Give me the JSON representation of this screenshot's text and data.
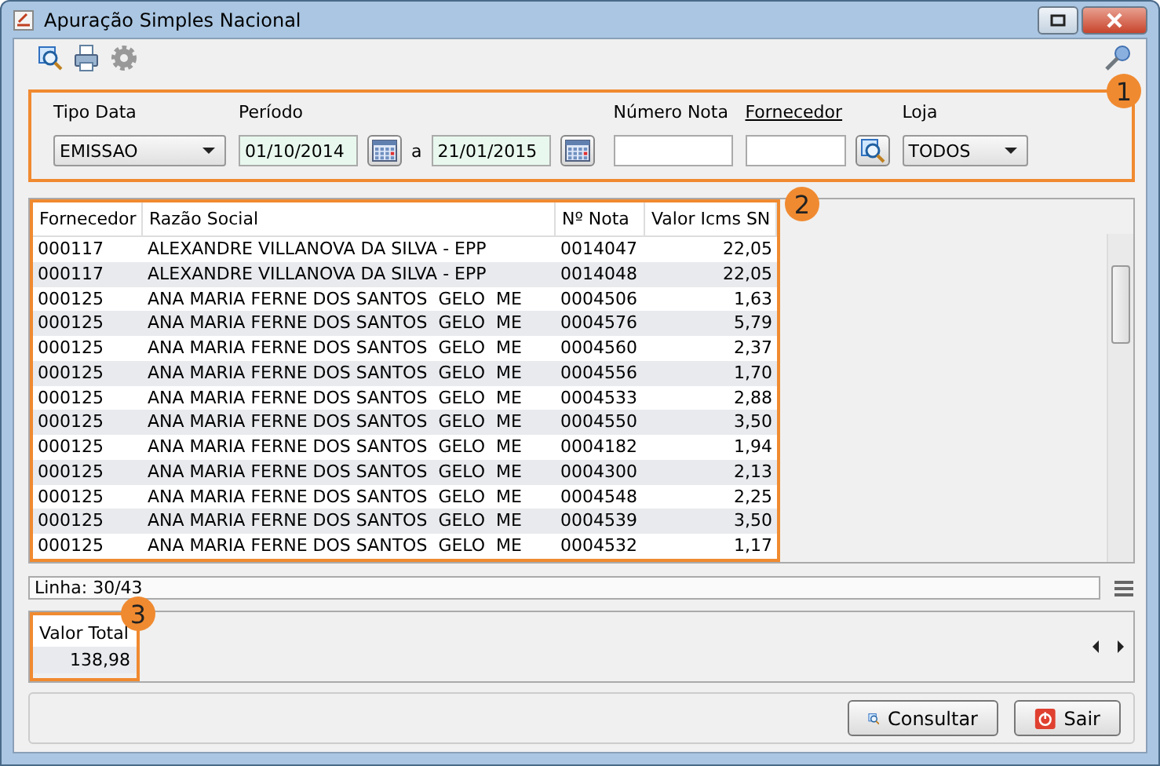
{
  "window": {
    "title": "Apuração Simples Nacional"
  },
  "filters": {
    "tipo_data": {
      "label": "Tipo Data",
      "value": "EMISSAO"
    },
    "periodo": {
      "label": "Período",
      "from": "01/10/2014",
      "separator": "a",
      "to": "21/01/2015"
    },
    "numero_nota": {
      "label": "Número Nota"
    },
    "fornecedor": {
      "label": "Fornecedor",
      "link": true
    },
    "loja": {
      "label": "Loja",
      "value": "TODOS"
    },
    "callout": "1"
  },
  "table": {
    "callout": "2",
    "columns": [
      "Fornecedor",
      "Razão Social",
      "Nº Nota",
      "Valor Icms SN"
    ],
    "rows": [
      [
        "000117",
        "ALEXANDRE VILLANOVA DA SILVA - EPP",
        "0014047",
        "22,05"
      ],
      [
        "000117",
        "ALEXANDRE VILLANOVA DA SILVA - EPP",
        "0014048",
        "22,05"
      ],
      [
        "000125",
        "ANA MARIA FERNE DOS SANTOS  GELO  ME",
        "0004506",
        "1,63"
      ],
      [
        "000125",
        "ANA MARIA FERNE DOS SANTOS  GELO  ME",
        "0004576",
        "5,79"
      ],
      [
        "000125",
        "ANA MARIA FERNE DOS SANTOS  GELO  ME",
        "0004560",
        "2,37"
      ],
      [
        "000125",
        "ANA MARIA FERNE DOS SANTOS  GELO  ME",
        "0004556",
        "1,70"
      ],
      [
        "000125",
        "ANA MARIA FERNE DOS SANTOS  GELO  ME",
        "0004533",
        "2,88"
      ],
      [
        "000125",
        "ANA MARIA FERNE DOS SANTOS  GELO  ME",
        "0004550",
        "3,50"
      ],
      [
        "000125",
        "ANA MARIA FERNE DOS SANTOS  GELO  ME",
        "0004182",
        "1,94"
      ],
      [
        "000125",
        "ANA MARIA FERNE DOS SANTOS  GELO  ME",
        "0004300",
        "2,13"
      ],
      [
        "000125",
        "ANA MARIA FERNE DOS SANTOS  GELO  ME",
        "0004548",
        "2,25"
      ],
      [
        "000125",
        "ANA MARIA FERNE DOS SANTOS  GELO  ME",
        "0004539",
        "3,50"
      ],
      [
        "000125",
        "ANA MARIA FERNE DOS SANTOS  GELO  ME",
        "0004532",
        "1,17"
      ]
    ]
  },
  "status": "Linha: 30/43",
  "totals": {
    "callout": "3",
    "label": "Valor Total",
    "value": "138,98"
  },
  "buttons": [
    {
      "kind": "search",
      "label": "Consultar"
    },
    {
      "kind": "exit",
      "label": "Sair"
    }
  ]
}
